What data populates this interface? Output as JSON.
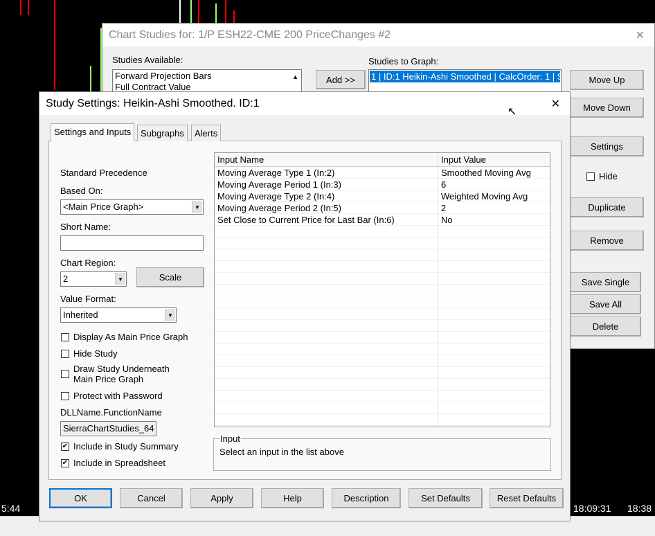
{
  "chart": {
    "time_labels": [
      "5:44",
      "18:09:31",
      "18:38"
    ]
  },
  "chart_studies": {
    "title": "Chart Studies for: 1/P ESH22-CME  200 PriceChanges  #2",
    "studies_available_label": "Studies Available:",
    "studies_available": [
      "Forward Projection Bars",
      "Full Contract Value"
    ],
    "add_button": "Add >>",
    "studies_to_graph_label": "Studies to Graph:",
    "studies_to_graph": [
      "1 | ID:1  Heikin-Ashi Smoothed | CalcOrder: 1 | S"
    ],
    "buttons": {
      "move_up": "Move Up",
      "move_down": "Move Down",
      "settings": "Settings",
      "hide": "Hide",
      "duplicate": "Duplicate",
      "remove": "Remove",
      "save_single": "Save Single",
      "save_all": "Save All",
      "delete": "Delete"
    }
  },
  "study_settings": {
    "title": "Study Settings: Heikin-Ashi Smoothed. ID:1",
    "tabs": [
      "Settings and Inputs",
      "Subgraphs",
      "Alerts"
    ],
    "standard_precedence": "Standard Precedence",
    "based_on_label": "Based On:",
    "based_on": "<Main Price Graph>",
    "short_name_label": "Short Name:",
    "short_name": "",
    "chart_region_label": "Chart Region:",
    "chart_region": "2",
    "scale_button": "Scale",
    "value_format_label": "Value Format:",
    "value_format": "Inherited",
    "checkboxes": [
      {
        "label": "Display As Main Price Graph",
        "checked": false
      },
      {
        "label": "Hide Study",
        "checked": false
      },
      {
        "label": "Draw Study Underneath Main Price Graph",
        "checked": false
      },
      {
        "label": "Protect with Password",
        "checked": false
      }
    ],
    "dll_label": "DLLName.FunctionName",
    "dll_value": "SierraChartStudies_64",
    "include_summary": {
      "label": "Include in Study Summary",
      "checked": true
    },
    "include_spreadsheet": {
      "label": "Include in Spreadsheet",
      "checked": true
    },
    "inputs_headers": [
      "Input Name",
      "Input Value"
    ],
    "inputs": [
      {
        "name": "Moving Average Type 1  (In:2)",
        "value": "Smoothed Moving Avg"
      },
      {
        "name": "Moving Average Period 1  (In:3)",
        "value": "6"
      },
      {
        "name": "Moving Average Type 2  (In:4)",
        "value": "Weighted Moving Avg"
      },
      {
        "name": "Moving Average Period 2  (In:5)",
        "value": "2"
      },
      {
        "name": "Set Close to Current Price for Last Bar  (In:6)",
        "value": "No"
      }
    ],
    "input_group_label": "Input",
    "input_hint": "Select an input in the list above",
    "buttons": {
      "ok": "OK",
      "cancel": "Cancel",
      "apply": "Apply",
      "help": "Help",
      "description": "Description",
      "set_defaults": "Set Defaults",
      "reset_defaults": "Reset Defaults"
    }
  }
}
